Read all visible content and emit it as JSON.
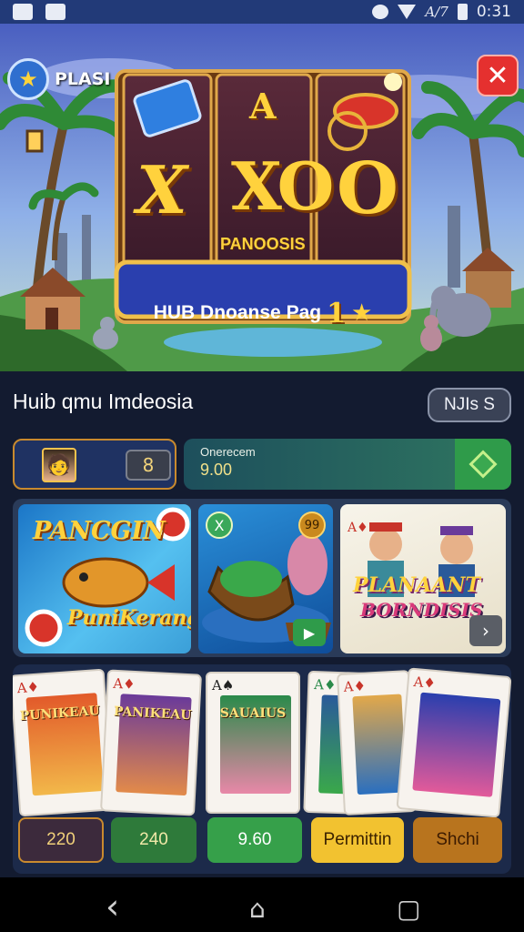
{
  "status_bar": {
    "left_icons": [
      "image-icon",
      "gamepad-icon"
    ],
    "right_text": "A/7",
    "time": "0:31"
  },
  "header": {
    "app_name": "PLASI",
    "close_symbol": "✕"
  },
  "banner": {
    "top_letter": "A",
    "slot_symbols": [
      "X",
      "XO",
      "O"
    ],
    "slot_label": "PANOOSIS",
    "banner_label": "HUB Dnoanse Pag",
    "banner_number": "1",
    "star": "★"
  },
  "main": {
    "title": "Huib qmu Imdeosia",
    "more_button": "NJIs S"
  },
  "account": {
    "count": "8",
    "balance_label": "Onerecem",
    "balance_value": "9.00"
  },
  "game_tiles": [
    {
      "title": "PANCGIN",
      "subtitle": "PuniKerang"
    },
    {
      "badge": "X",
      "coin": "99",
      "play": "▶"
    },
    {
      "title": "PLANAANT",
      "subtitle": "BORNDISIS",
      "next": "›"
    }
  ],
  "cards": [
    {
      "corner": "A♦",
      "label": "PUNIKEAU"
    },
    {
      "corner": "A♦",
      "label": "PANIKEAU"
    },
    {
      "corner": "A♠",
      "label": "SAUAIUS"
    },
    {
      "corner": "A♦",
      "label": ""
    },
    {
      "corner": "A♦",
      "label": ""
    },
    {
      "corner": "A♦",
      "label": ""
    }
  ],
  "bottom_buttons": [
    "220",
    "240",
    "9.60",
    "Permittin",
    "Shchi"
  ],
  "nav": {
    "back": "‹",
    "home": "⌂",
    "recents": "▢"
  },
  "colors": {
    "accent_red": "#e5302f",
    "accent_green": "#36a04a",
    "accent_gold": "#f2c230",
    "panel_blue": "#1f3262"
  }
}
